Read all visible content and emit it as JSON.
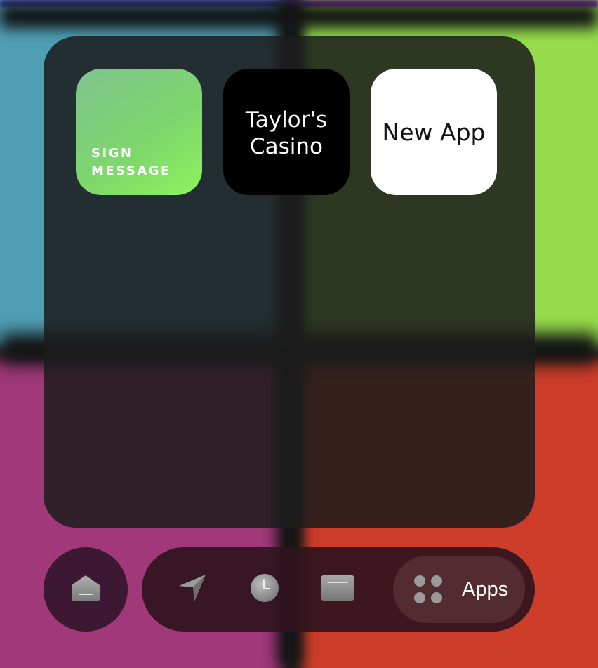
{
  "tiles": [
    {
      "label": "SIGN\nMESSAGE",
      "line1": "SIGN",
      "line2": "MESSAGE"
    },
    {
      "label": "Taylor's Casino",
      "line1": "Taylor's",
      "line2": "Casino"
    },
    {
      "label": "New App"
    }
  ],
  "dock": {
    "home_icon": "home-icon",
    "navigation_icon": "navigation-arrow-icon",
    "clock_icon": "clock-icon",
    "card_icon": "card-icon",
    "apps_icon": "apps-grid-icon",
    "apps_label": "Apps"
  },
  "colors": {
    "panel": "#1c1c1c",
    "sign_tile_gradient": [
      "#7ec38e",
      "#8ef45e"
    ],
    "bg_top_left": "#4f9fb4",
    "bg_top_right": "#96dc4c",
    "bg_bottom_left": "#a0387a",
    "bg_bottom_right": "#cd3d29"
  }
}
